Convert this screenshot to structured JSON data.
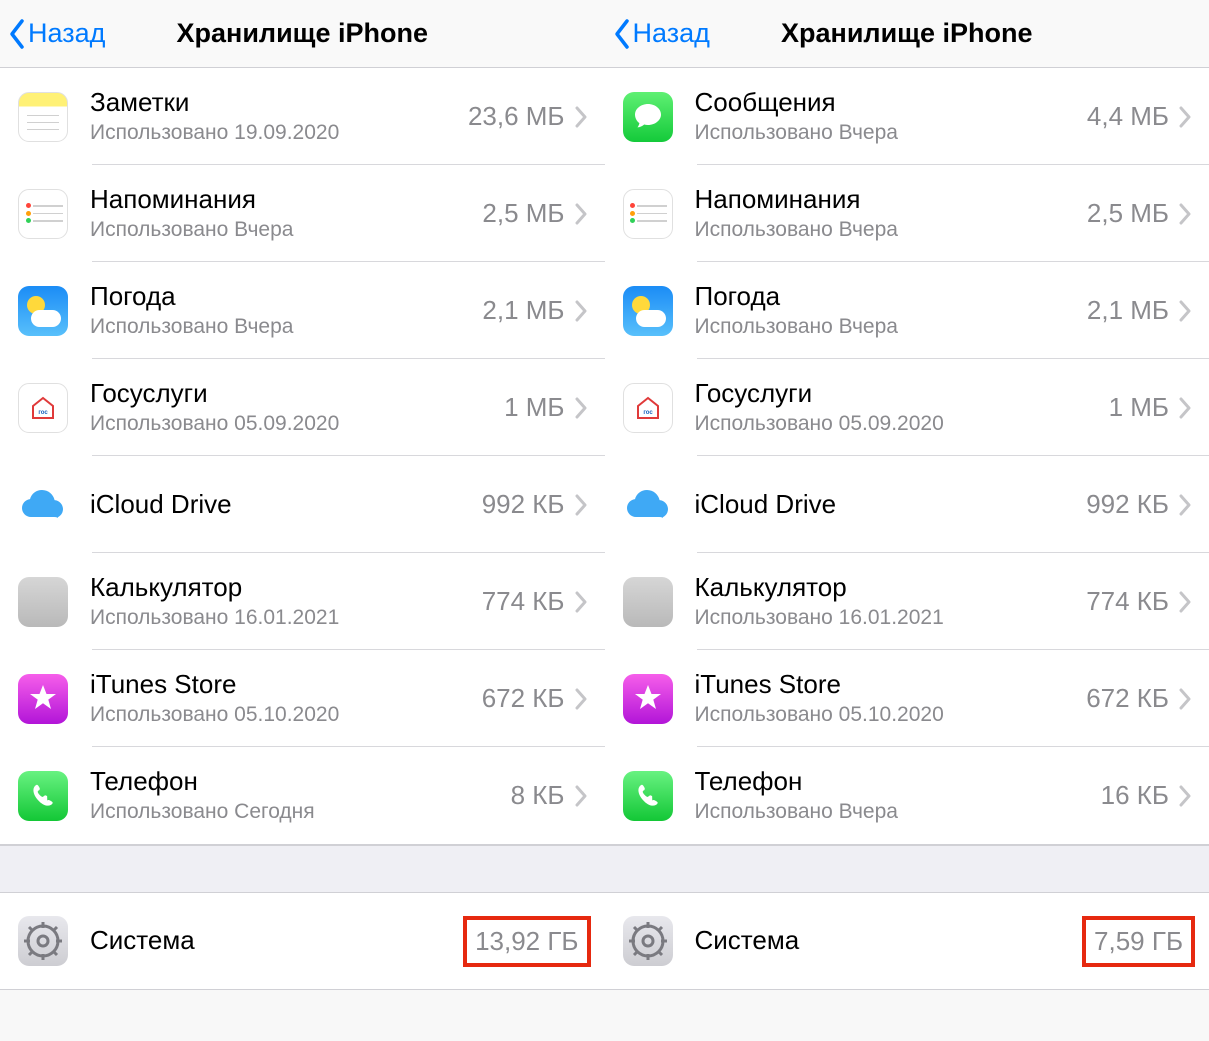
{
  "panels": [
    {
      "back": "Назад",
      "title": "Хранилище iPhone",
      "apps": [
        {
          "icon": "notes",
          "name": "Заметки",
          "sub": "Использовано 19.09.2020",
          "size": "23,6 МБ"
        },
        {
          "icon": "reminders",
          "name": "Напоминания",
          "sub": "Использовано Вчера",
          "size": "2,5 МБ"
        },
        {
          "icon": "weather",
          "name": "Погода",
          "sub": "Использовано Вчера",
          "size": "2,1 МБ"
        },
        {
          "icon": "gosuslugi",
          "name": "Госуслуги",
          "sub": "Использовано 05.09.2020",
          "size": "1 МБ"
        },
        {
          "icon": "icloud",
          "name": "iCloud Drive",
          "sub": "",
          "size": "992 КБ"
        },
        {
          "icon": "calculator",
          "name": "Калькулятор",
          "sub": "Использовано 16.01.2021",
          "size": "774 КБ"
        },
        {
          "icon": "itunes",
          "name": "iTunes Store",
          "sub": "Использовано 05.10.2020",
          "size": "672 КБ"
        },
        {
          "icon": "phone",
          "name": "Телефон",
          "sub": "Использовано Сегодня",
          "size": "8 КБ"
        }
      ],
      "system": {
        "name": "Система",
        "size": "13,92 ГБ"
      }
    },
    {
      "back": "Назад",
      "title": "Хранилище iPhone",
      "apps": [
        {
          "icon": "messages",
          "name": "Сообщения",
          "sub": "Использовано Вчера",
          "size": "4,4 МБ"
        },
        {
          "icon": "reminders",
          "name": "Напоминания",
          "sub": "Использовано Вчера",
          "size": "2,5 МБ"
        },
        {
          "icon": "weather",
          "name": "Погода",
          "sub": "Использовано Вчера",
          "size": "2,1 МБ"
        },
        {
          "icon": "gosuslugi",
          "name": "Госуслуги",
          "sub": "Использовано 05.09.2020",
          "size": "1 МБ"
        },
        {
          "icon": "icloud",
          "name": "iCloud Drive",
          "sub": "",
          "size": "992 КБ"
        },
        {
          "icon": "calculator",
          "name": "Калькулятор",
          "sub": "Использовано 16.01.2021",
          "size": "774 КБ"
        },
        {
          "icon": "itunes",
          "name": "iTunes Store",
          "sub": "Использовано 05.10.2020",
          "size": "672 КБ"
        },
        {
          "icon": "phone",
          "name": "Телефон",
          "sub": "Использовано Вчера",
          "size": "16 КБ"
        }
      ],
      "system": {
        "name": "Система",
        "size": "7,59 ГБ"
      }
    }
  ]
}
